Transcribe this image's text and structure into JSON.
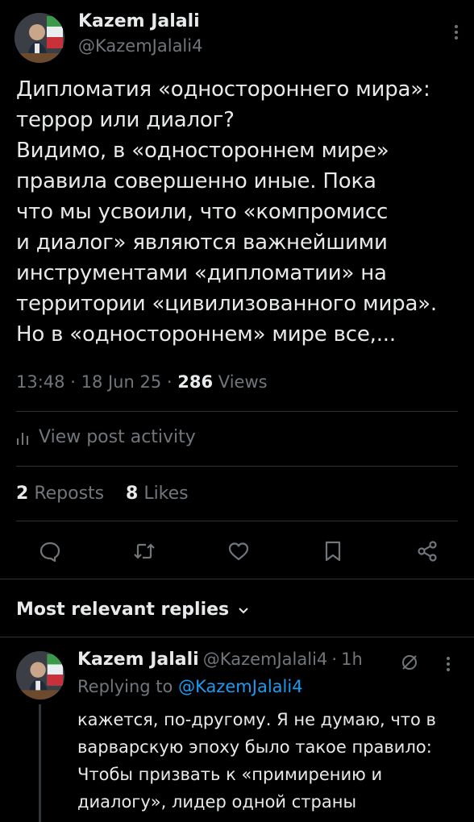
{
  "post": {
    "author_name": "Kazem Jalali",
    "author_handle": "@KazemJalali4",
    "text": "Дипломатия «одностороннего мира»:\nтеррор или диалог?\nВидимо, в «одностороннем мире»\nправила совершенно иные. Пока\nчто мы усвоили, что «компромисс\nи диалог» являются важнейшими\nинструментами «дипломатии» на\nтерритории «цивилизованного мира».\nНо в «одностороннем» мире все,...",
    "time": "13:48",
    "date": "18 Jun 25",
    "views_count": "286",
    "views_label": "Views",
    "separator": "·"
  },
  "activity": {
    "label": "View post activity"
  },
  "stats": {
    "reposts_count": "2",
    "reposts_label": "Reposts",
    "likes_count": "8",
    "likes_label": "Likes"
  },
  "actions": {
    "icons": [
      "reply-icon",
      "repost-icon",
      "like-icon",
      "bookmark-icon",
      "share-icon"
    ]
  },
  "replies_section": {
    "title": "Most relevant replies"
  },
  "reply": {
    "author_name": "Kazem Jalali",
    "author_handle": "@KazemJalali4",
    "time_ago": "1h",
    "separator": "·",
    "replying_to_label": "Replying to",
    "replying_to_handle": "@KazemJalali4",
    "text": "кажется, по-другому. Я не думаю, что в\nварварскую эпоху было такое правило:\nЧтобы призвать к «примирению и\nдиалогу», лидер одной страны"
  },
  "colors": {
    "background": "#000000",
    "text_primary": "#e7e9ea",
    "text_secondary": "#71767b",
    "accent": "#1d9bf0",
    "divider": "#2f3336"
  }
}
